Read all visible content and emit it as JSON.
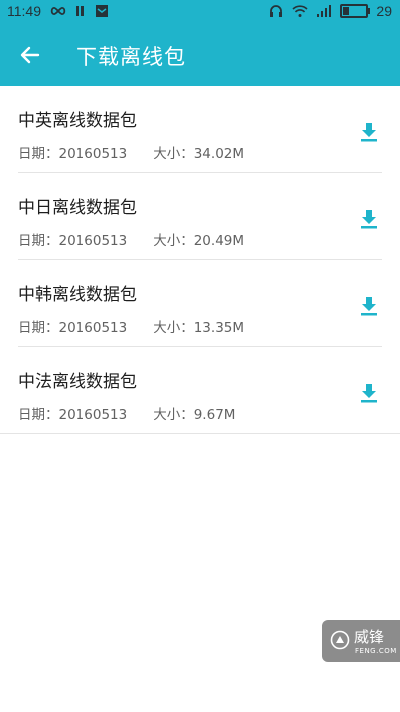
{
  "status_bar": {
    "time": "11:49",
    "battery": "29"
  },
  "header": {
    "title": "下载离线包"
  },
  "packages": [
    {
      "name": "中英离线数据包",
      "date": "日期：20160513",
      "size": "大小：34.02M"
    },
    {
      "name": "中日离线数据包",
      "date": "日期：20160513",
      "size": "大小：20.49M"
    },
    {
      "name": "中韩离线数据包",
      "date": "日期：20160513",
      "size": "大小：13.35M"
    },
    {
      "name": "中法离线数据包",
      "date": "日期：20160513",
      "size": "大小：9.67M"
    }
  ],
  "watermark": {
    "brand": "威锋",
    "sub": "FENG.COM"
  },
  "colors": {
    "accent": "#1fb4cb",
    "download_icon": "#1fb4cb"
  },
  "icons": {
    "back": "arrow-left-icon",
    "download": "download-icon"
  }
}
